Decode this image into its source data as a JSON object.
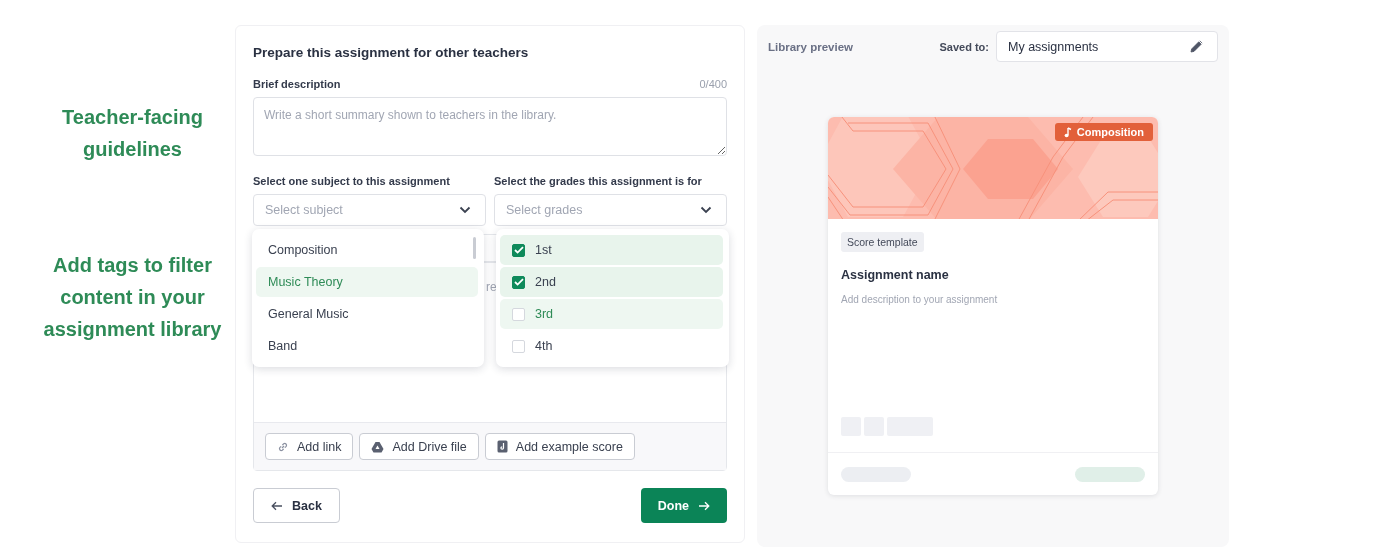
{
  "side_labels": [
    "Teacher-facing guidelines",
    "Add tags to filter content in your assignment library"
  ],
  "form": {
    "title": "Prepare this assignment for other teachers",
    "description": {
      "label": "Brief description",
      "counter": "0/400",
      "placeholder": "Write a short summary shown to teachers in the library."
    },
    "subject": {
      "label": "Select one subject to this assignment",
      "placeholder": "Select subject",
      "open": true,
      "options": [
        {
          "label": "Composition",
          "highlighted": false
        },
        {
          "label": "Music Theory",
          "highlighted": true
        },
        {
          "label": "General Music",
          "highlighted": false
        },
        {
          "label": "Band",
          "highlighted": false
        }
      ]
    },
    "grades": {
      "label": "Select the grades this assignment is for",
      "placeholder": "Select grades",
      "open": true,
      "options": [
        {
          "label": "1st",
          "checked": true,
          "highlighted": false
        },
        {
          "label": "2nd",
          "checked": true,
          "highlighted": false
        },
        {
          "label": "3rd",
          "checked": false,
          "highlighted": true
        },
        {
          "label": "4th",
          "checked": false,
          "highlighted": false
        }
      ]
    },
    "covered_hint": "re",
    "attach_buttons": [
      {
        "label": "Add link",
        "kind": "link"
      },
      {
        "label": "Add Drive file",
        "kind": "drive"
      },
      {
        "label": "Add example score",
        "kind": "score"
      }
    ],
    "back": "Back",
    "done": "Done"
  },
  "preview": {
    "title": "Library preview",
    "saved_label": "Saved to:",
    "saved_value": "My assignments",
    "card": {
      "badge": "Composition",
      "tag": "Score template",
      "name": "Assignment name",
      "description": "Add description to your assignment"
    }
  }
}
